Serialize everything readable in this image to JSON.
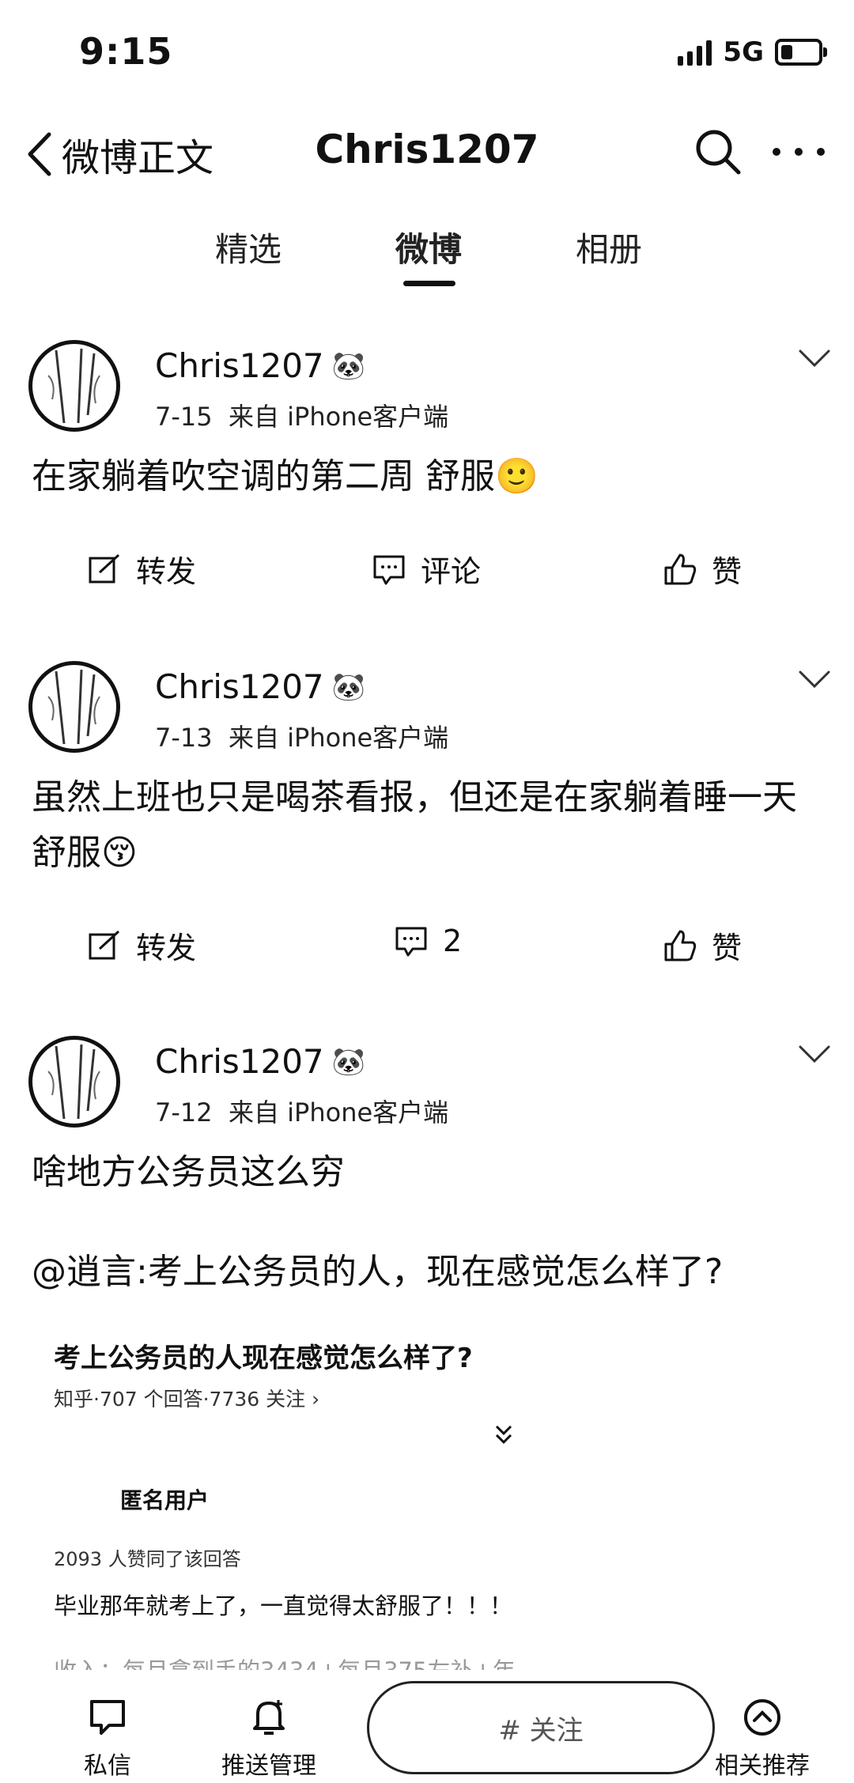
{
  "status_bar": {
    "time": "9:15",
    "network": "5G"
  },
  "nav": {
    "back_label": "微博正文",
    "title": "Chris1207"
  },
  "tabs": [
    {
      "label": "精选"
    },
    {
      "label": "微博"
    },
    {
      "label": "相册"
    }
  ],
  "posts": [
    {
      "username": "Chris1207",
      "date": "7-15",
      "source": "来自 iPhone客户端",
      "text": "在家躺着吹空调的第二周 舒服🙂",
      "repost_label": "转发",
      "comment_label": "评论",
      "like_label": "赞"
    },
    {
      "username": "Chris1207",
      "date": "7-13",
      "source": "来自 iPhone客户端",
      "text": "虽然上班也只是喝茶看报，但还是在家躺着睡一天舒服😚",
      "repost_label": "转发",
      "comment_label": "2",
      "like_label": "赞"
    },
    {
      "username": "Chris1207",
      "date": "7-12",
      "source": "来自 iPhone客户端",
      "text": "啥地方公务员这么穷",
      "quote": "@逍言:考上公务员的人，现在感觉怎么样了?"
    }
  ],
  "quote_card": {
    "title": "考上公务员的人现在感觉怎么样了?",
    "meta": "知乎·707 个回答·7736 关注 ›",
    "user": "匿名用户",
    "agree": "2093 人赞同了该回答",
    "answer": "毕业那年就考上了，一直觉得太舒服了！！！",
    "cut_text": "收入：每月拿到手的3434+每月375左补+年"
  },
  "bottom_bar": {
    "dm_label": "私信",
    "push_label": "推送管理",
    "center_label": "# 关注",
    "profile_label": "相关推荐"
  }
}
